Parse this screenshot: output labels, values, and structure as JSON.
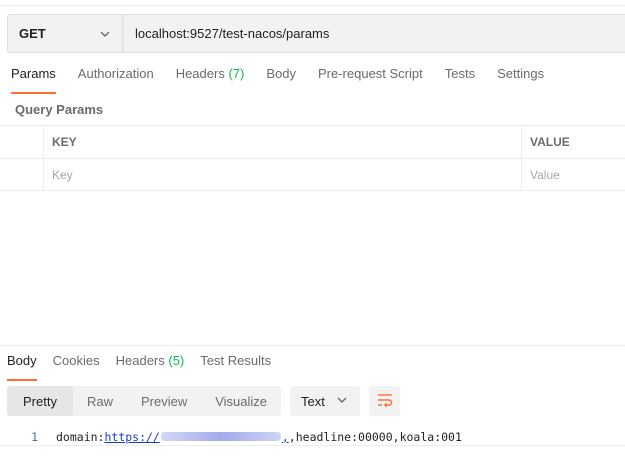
{
  "request": {
    "method": "GET",
    "url": "localhost:9527/test-nacos/params"
  },
  "request_tabs": [
    {
      "label": "Params",
      "count": ""
    },
    {
      "label": "Authorization",
      "count": ""
    },
    {
      "label": "Headers",
      "count": "(7)"
    },
    {
      "label": "Body",
      "count": ""
    },
    {
      "label": "Pre-request Script",
      "count": ""
    },
    {
      "label": "Tests",
      "count": ""
    },
    {
      "label": "Settings",
      "count": ""
    }
  ],
  "params": {
    "title": "Query Params",
    "key_header": "KEY",
    "value_header": "VALUE",
    "key_placeholder": "Key",
    "value_placeholder": "Value"
  },
  "response_tabs": [
    {
      "label": "Body",
      "count": ""
    },
    {
      "label": "Cookies",
      "count": ""
    },
    {
      "label": "Headers",
      "count": "(5)"
    },
    {
      "label": "Test Results",
      "count": ""
    }
  ],
  "view_modes": [
    "Pretty",
    "Raw",
    "Preview",
    "Visualize"
  ],
  "format": "Text",
  "response_body": {
    "line_number": "1",
    "prefix": "domain:",
    "link_start": "https://",
    "link_end": ",",
    "suffix": ",headline:00000,koala:001"
  },
  "colors": {
    "accent": "#ff6c37",
    "count_green": "#0cbb52",
    "link": "#1a3ad6"
  }
}
